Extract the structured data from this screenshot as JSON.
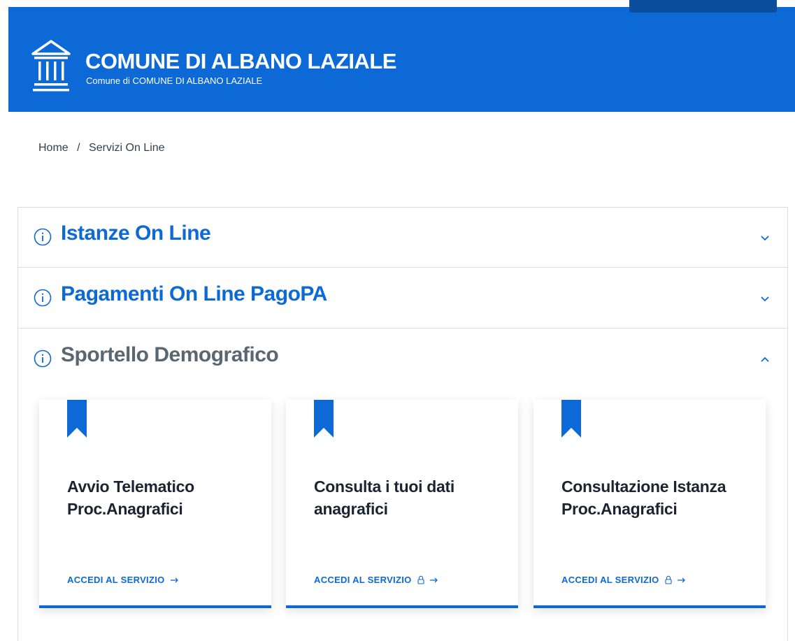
{
  "header": {
    "title": "COMUNE DI ALBANO LAZIALE",
    "subtitle": "Comune di COMUNE DI ALBANO LAZIALE",
    "logo_icon": "town-hall-icon",
    "background_color": "#0c69d6"
  },
  "breadcrumb": {
    "home": "Home",
    "separator": "/",
    "current": "Servizi On Line"
  },
  "accordion": {
    "sections": [
      {
        "title": "Istanze On Line",
        "state": "collapsed",
        "icon": "info-icon"
      },
      {
        "title": "Pagamenti On Line PagoPA",
        "state": "collapsed",
        "icon": "info-icon"
      },
      {
        "title": "Sportello Demografico",
        "state": "expanded",
        "icon": "info-icon"
      }
    ]
  },
  "cards": [
    {
      "title": "Avvio Telematico Proc.Anagrafici",
      "link_label": "ACCEDI AL SERVIZIO",
      "locked": false
    },
    {
      "title": "Consulta i tuoi dati anagrafici",
      "link_label": "ACCEDI AL SERVIZIO",
      "locked": true
    },
    {
      "title": "Consultazione Istanza Proc.Anagrafici",
      "link_label": "ACCEDI AL SERVIZIO",
      "locked": true
    }
  ],
  "colors": {
    "primary": "#0c69d6",
    "muted_title": "#5a6773",
    "text": "#1b2430"
  }
}
